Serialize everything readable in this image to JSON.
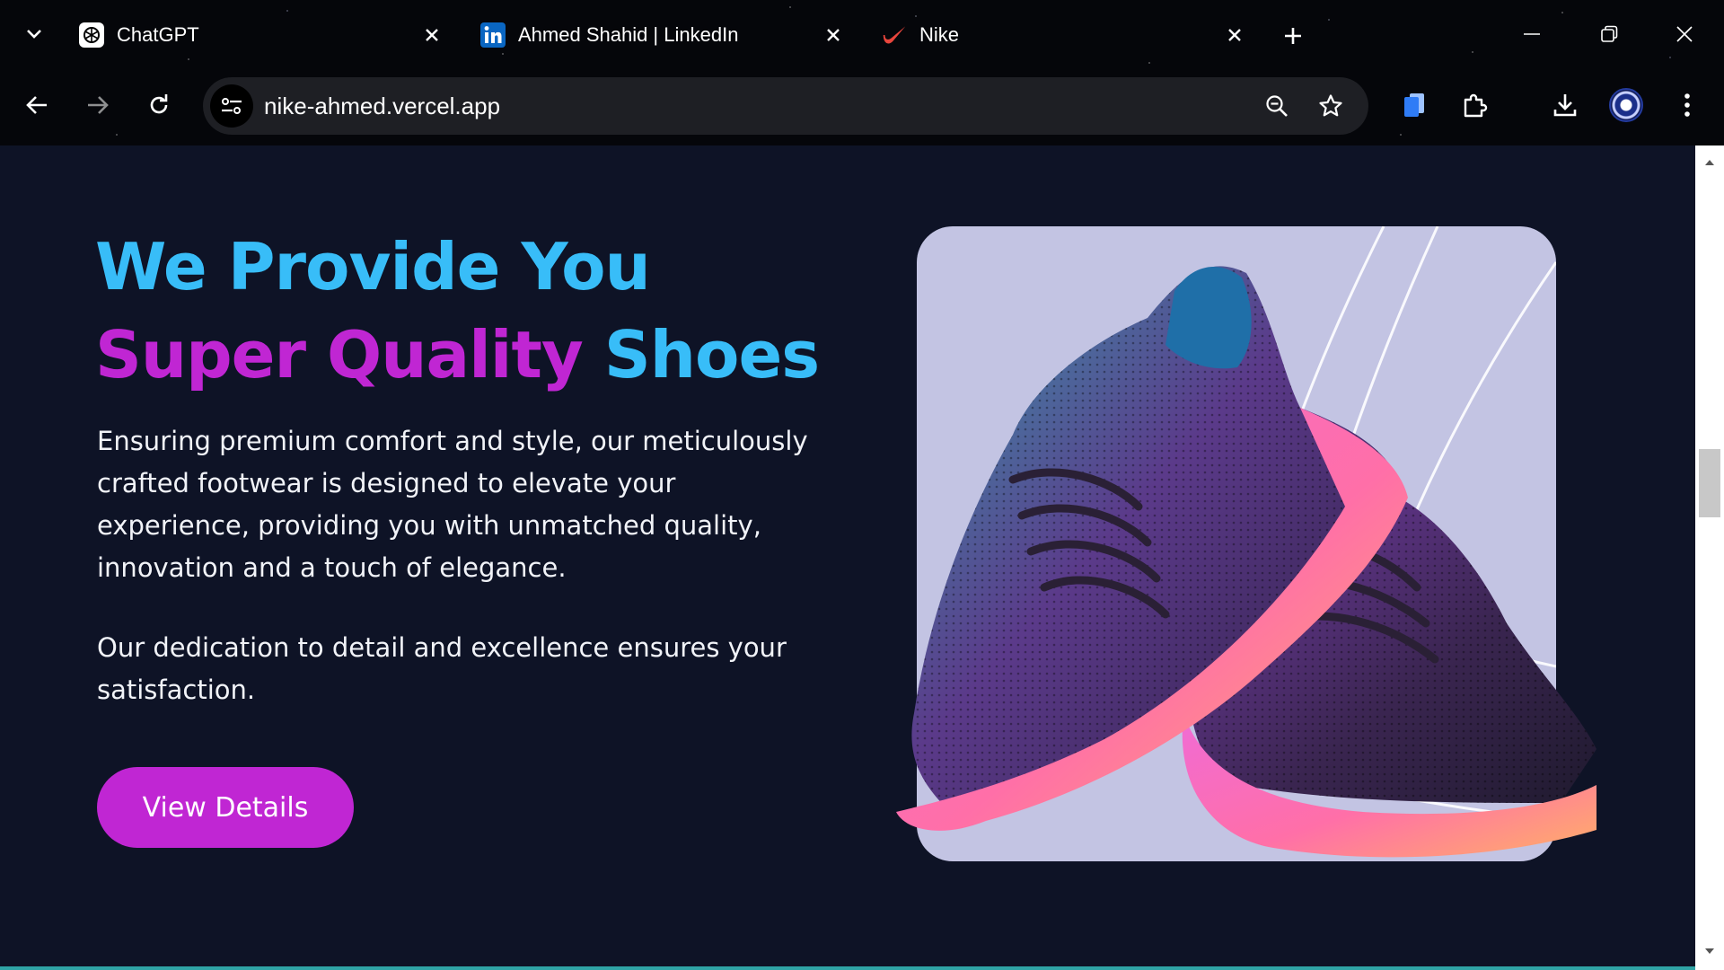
{
  "browser": {
    "tabs": [
      {
        "title": "ChatGPT",
        "icon": "chatgpt-icon"
      },
      {
        "title": "Ahmed Shahid | LinkedIn",
        "icon": "linkedin-icon"
      },
      {
        "title": "Nike",
        "icon": "nike-swoosh-icon"
      }
    ],
    "url": "nike-ahmed.vercel.app"
  },
  "hero": {
    "title_line1": "We Provide You",
    "title_line2_accent": "Super Quality",
    "title_line2_rest": " Shoes",
    "paragraph1": "Ensuring premium comfort and style, our meticulously crafted footwear is designed to elevate your experience, providing you with unmatched quality, innovation and a touch of elegance.",
    "paragraph2": "Our dedication to detail and excellence ensures your satisfaction.",
    "button_label": "View Details"
  },
  "colors": {
    "page_bg": "#0e1326",
    "accent_blue": "#38bdf8",
    "accent_purple": "#c026d3",
    "card_bg": "#c3c4e3"
  }
}
